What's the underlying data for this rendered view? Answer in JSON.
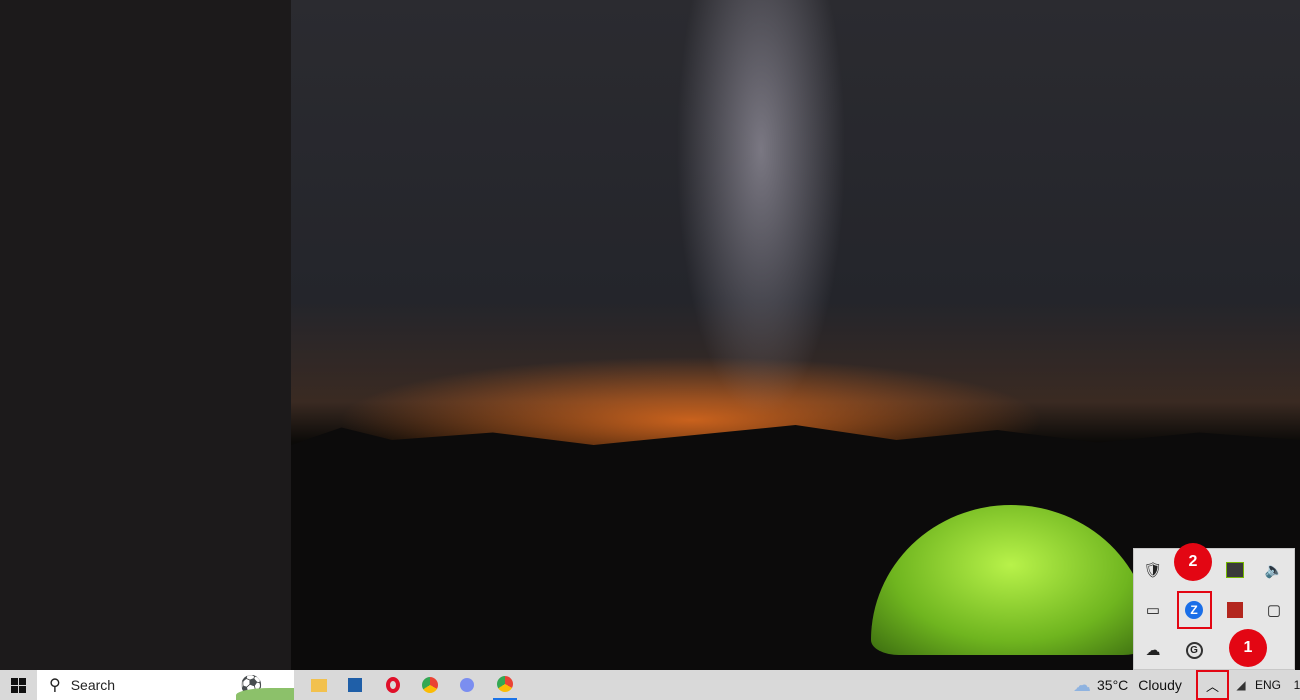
{
  "taskbar": {
    "search_placeholder": "Search",
    "apps": [
      "file-explorer",
      "microsoft-store",
      "opera",
      "chrome",
      "copilot",
      "chrome-profile"
    ],
    "weather": {
      "temp": "35°C",
      "condition": "Cloudy"
    },
    "language": "ENG",
    "clock_partial": "1"
  },
  "tray": {
    "icons": [
      "windows-security",
      "nvidia",
      "volume",
      "power",
      "zoom",
      "acrobat",
      "meet-now",
      "onedrive",
      "grammarly"
    ]
  },
  "annotations": {
    "step1": "1",
    "step2": "2",
    "color": "#e30613"
  }
}
